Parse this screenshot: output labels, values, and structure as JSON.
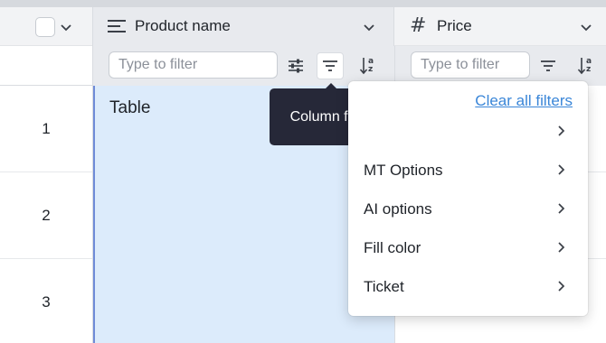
{
  "header": {
    "product_col_title": "Product name",
    "price_col_title": "Price",
    "price_col_type_symbol": "#",
    "product_col_type_icon": "text-lines-icon"
  },
  "filters": {
    "product_placeholder": "Type to filter",
    "price_placeholder": "Type to filter",
    "product_icons": [
      "sliders-icon",
      "filter-icon",
      "sort-az-icon"
    ],
    "price_icons": [
      "filter-icon",
      "sort-az-icon"
    ],
    "sort_letter_top": "a",
    "sort_letter_bottom": "z"
  },
  "rows": [
    {
      "num": "1",
      "product": "Table"
    },
    {
      "num": "2",
      "product": ""
    },
    {
      "num": "3",
      "product": ""
    }
  ],
  "tooltip": {
    "text": "Column filter"
  },
  "menu": {
    "clear_label": "Clear all filters",
    "items": [
      {
        "label": ""
      },
      {
        "label": "MT Options"
      },
      {
        "label": "AI options"
      },
      {
        "label": "Fill color"
      },
      {
        "label": "Ticket"
      }
    ]
  },
  "colors": {
    "selected_cell_bg": "#dcebfb",
    "selected_cell_border": "#6f8bd7",
    "tooltip_bg": "#262838",
    "link": "#3a86d8",
    "header_bg": "#e8eaee"
  }
}
